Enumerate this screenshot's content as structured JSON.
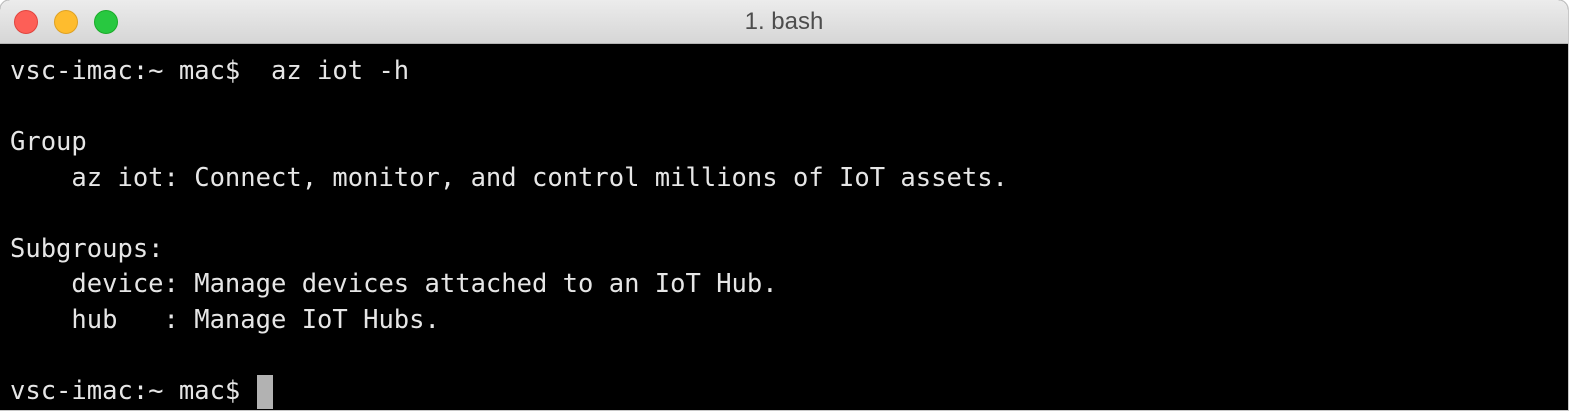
{
  "window": {
    "title": "1. bash"
  },
  "terminal": {
    "lines": [
      "vsc-imac:~ mac$  az iot -h",
      "",
      "Group",
      "    az iot: Connect, monitor, and control millions of IoT assets.",
      "",
      "Subgroups:",
      "    device: Manage devices attached to an IoT Hub.",
      "    hub   : Manage IoT Hubs.",
      "",
      "vsc-imac:~ mac$ "
    ]
  },
  "colors": {
    "background": "#000000",
    "text": "#e6e6e6",
    "cursor": "#b2b2b2",
    "close_button": "#fd5f57",
    "minimize_button": "#febc2e",
    "maximize_button": "#28c840"
  },
  "icons": {
    "close": "close-icon",
    "minimize": "minimize-icon",
    "maximize": "maximize-icon"
  }
}
